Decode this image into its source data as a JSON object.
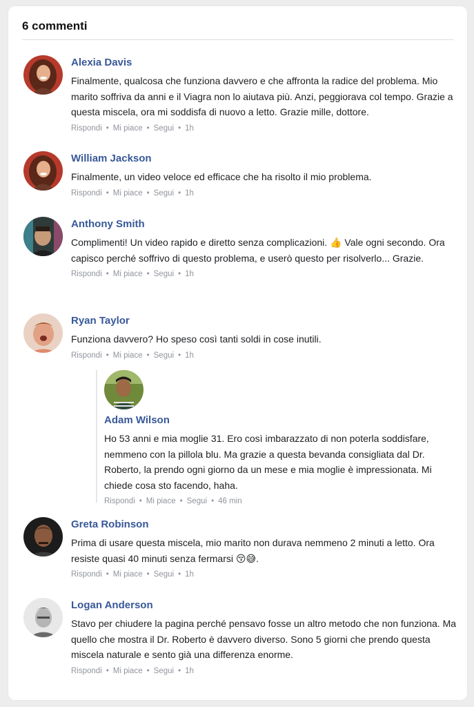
{
  "header": {
    "title": "6 commenti"
  },
  "actions": {
    "reply": "Rispondi",
    "like": "Mi piace",
    "follow": "Segui",
    "sep": "•"
  },
  "comments": [
    {
      "author": "Alexia Davis",
      "text": "Finalmente, qualcosa che funziona davvero e che affronta la radice del problema. Mio marito soffriva da anni e il Viagra non lo aiutava più. Anzi, peggiorava col tempo. Grazie a questa miscela, ora mi soddisfa di nuovo a letto. Grazie mille, dottore.",
      "time": "1h"
    },
    {
      "author": "William Jackson",
      "text": "Finalmente, un video veloce ed efficace che ha risolto il mio problema.",
      "time": "1h"
    },
    {
      "author": "Anthony Smith",
      "text": "Complimenti! Un video rapido e diretto senza complicazioni. 👍 Vale ogni secondo. Ora capisco perché soffrivo di questo problema, e userò questo per risolverlo... Grazie.",
      "time": "1h"
    },
    {
      "author": "Ryan Taylor",
      "text": "Funziona davvero? Ho speso così tanti soldi in cose inutili.",
      "time": "1h"
    },
    {
      "author": "Adam Wilson",
      "text": "Ho 53 anni e mia moglie 31. Ero così imbarazzato di non poterla soddisfare, nemmeno con la pillola blu. Ma grazie a questa bevanda consigliata dal Dr. Roberto, la prendo ogni giorno da un mese e mia moglie è impressionata. Mi chiede cosa sto facendo, haha.",
      "time": "46 min"
    },
    {
      "author": "Greta Robinson",
      "text": "Prima di usare questa miscela, mio marito non durava nemmeno 2 minuti a letto. Ora resiste quasi 40 minuti senza fermarsi 😚😅.",
      "time": "1h"
    },
    {
      "author": "Logan Anderson",
      "text": "Stavo per chiudere la pagina perché pensavo fosse un altro metodo che non funziona. Ma quello che mostra il Dr. Roberto è davvero diverso. Sono 5 giorni che prendo questa miscela naturale e sento già una differenza enorme.",
      "time": "1h"
    }
  ],
  "colors": {
    "author": "#385898",
    "meta": "#90949c",
    "text": "#1c1e21"
  }
}
